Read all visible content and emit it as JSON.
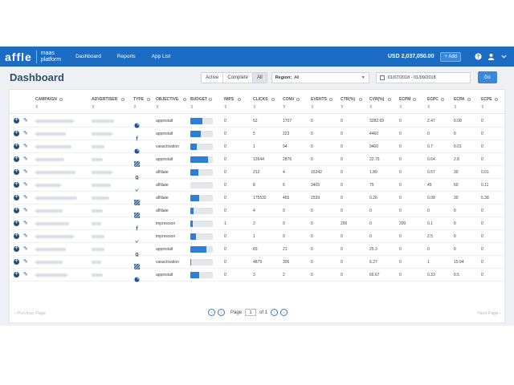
{
  "topbar": {
    "logo": "affle",
    "logo_sub_line1": "maas",
    "logo_sub_line2": "platform",
    "nav": [
      "Dashboard",
      "Reports",
      "App List"
    ],
    "balance": "USD 2,037,050.00",
    "add_label": "+ Add",
    "colors": {
      "bar": "#1d6cc4",
      "accent": "#2b7fd8"
    }
  },
  "header": {
    "title": "Dashboard",
    "status_filters": [
      "Active",
      "Complete",
      "All"
    ],
    "selected_status": "All",
    "region_label": "Region:",
    "region_value": "All",
    "date_range": "01/07/2018 - 01/09/2018",
    "go_label": "Go"
  },
  "table": {
    "columns": [
      "CAMPAIGN",
      "ADVERTISER",
      "TYPE",
      "OBJECTIVE",
      "BUDGET",
      "IMPS",
      "CLICKS",
      "CONV",
      "EVENTS",
      "CTR(%)",
      "CVR(%)",
      "ECPM",
      "ECPC",
      "ECPA",
      "ECPE"
    ],
    "rows": [
      {
        "type_icon": "pie",
        "objective": "appinstall",
        "budget": 0.55,
        "imps": "0",
        "clicks": "52",
        "conv": "1707",
        "events": "0",
        "ctr": "0",
        "cvr": "3282.69",
        "ecpm": "0",
        "ecpc": "2.47",
        "ecpa": "0.08",
        "ecpe": "0"
      },
      {
        "type_icon": "facebook",
        "objective": "appinstall",
        "budget": 0.45,
        "imps": "0",
        "clicks": "5",
        "conv": "223",
        "events": "0",
        "ctr": "0",
        "cvr": "4460",
        "ecpm": "0",
        "ecpc": "0",
        "ecpa": "0",
        "ecpe": "0"
      },
      {
        "type_icon": "pie",
        "objective": "vasactivation",
        "budget": 0.3,
        "imps": "0",
        "clicks": "1",
        "conv": "94",
        "events": "0",
        "ctr": "0",
        "cvr": "9400",
        "ecpm": "0",
        "ecpc": "0.7",
        "ecpa": "0.01",
        "ecpe": "0"
      },
      {
        "type_icon": "grid",
        "objective": "appinstall",
        "budget": 0.8,
        "imps": "0",
        "clicks": "12644",
        "conv": "2876",
        "events": "0",
        "ctr": "0",
        "cvr": "22.75",
        "ecpm": "0",
        "ecpc": "0.64",
        "ecpa": "2.8",
        "ecpe": "0"
      },
      {
        "type_icon": "google",
        "objective": "affiliate",
        "budget": 0.35,
        "imps": "0",
        "clicks": "212",
        "conv": "4",
        "events": "15242",
        "ctr": "0",
        "cvr": "1.89",
        "ecpm": "0",
        "ecpc": "0.57",
        "ecpa": "30",
        "ecpe": "0.01"
      },
      {
        "type_icon": "twitter",
        "objective": "affiliate",
        "budget": 0.0,
        "imps": "0",
        "clicks": "8",
        "conv": "6",
        "events": "3405",
        "ctr": "0",
        "cvr": "75",
        "ecpm": "0",
        "ecpc": "45",
        "ecpa": "60",
        "ecpe": "0.11"
      },
      {
        "type_icon": "grid",
        "objective": "affiliate",
        "budget": 0.4,
        "imps": "0",
        "clicks": "175532",
        "conv": "455",
        "events": "2539",
        "ctr": "0",
        "cvr": "0.26",
        "ecpm": "0",
        "ecpc": "0.08",
        "ecpa": "30",
        "ecpe": "5.38"
      },
      {
        "type_icon": "grid",
        "objective": "affiliate",
        "budget": 0.15,
        "imps": "0",
        "clicks": "4",
        "conv": "0",
        "events": "0",
        "ctr": "0",
        "cvr": "0",
        "ecpm": "0",
        "ecpc": "0",
        "ecpa": "0",
        "ecpe": "0"
      },
      {
        "type_icon": "facebook",
        "objective": "impression",
        "budget": 0.1,
        "imps": "1",
        "clicks": "2",
        "conv": "0",
        "events": "0",
        "ctr": "200",
        "cvr": "0",
        "ecpm": "200",
        "ecpc": "0.1",
        "ecpa": "0",
        "ecpe": "0"
      },
      {
        "type_icon": "twitter",
        "objective": "impression",
        "budget": 0.25,
        "imps": "0",
        "clicks": "1",
        "conv": "0",
        "events": "0",
        "ctr": "0",
        "cvr": "0",
        "ecpm": "0",
        "ecpc": "2.5",
        "ecpa": "0",
        "ecpe": "0"
      },
      {
        "type_icon": "google",
        "objective": "appinstall",
        "budget": 0.7,
        "imps": "0",
        "clicks": "83",
        "conv": "21",
        "events": "0",
        "ctr": "0",
        "cvr": "25.3",
        "ecpm": "0",
        "ecpc": "0",
        "ecpa": "0",
        "ecpe": "0"
      },
      {
        "type_icon": "grid",
        "objective": "vasactivation",
        "budget": 0.05,
        "imps": "0",
        "clicks": "4879",
        "conv": "306",
        "events": "0",
        "ctr": "0",
        "cvr": "6.27",
        "ecpm": "0",
        "ecpc": "1",
        "ecpa": "15.94",
        "ecpe": "0"
      },
      {
        "type_icon": "pie",
        "objective": "appinstall",
        "budget": 0.4,
        "imps": "0",
        "clicks": "3",
        "conv": "2",
        "events": "0",
        "ctr": "0",
        "cvr": "66.67",
        "ecpm": "0",
        "ecpc": "0.33",
        "ecpa": "0.5",
        "ecpe": "0"
      }
    ]
  },
  "pagination": {
    "prev_label": "Previous Page",
    "next_label": "Next Page",
    "page_label": "Page",
    "page_value": "1",
    "of_label": "of 1"
  }
}
